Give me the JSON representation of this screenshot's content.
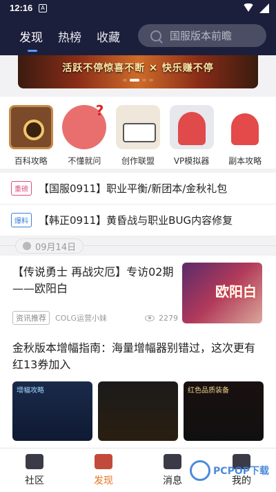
{
  "status": {
    "time": "12:16",
    "notif_icon": "A"
  },
  "header": {
    "tabs": [
      {
        "label": "发现",
        "active": true
      },
      {
        "label": "热榜",
        "active": false
      },
      {
        "label": "收藏",
        "active": false
      }
    ],
    "search_placeholder": "国服版本前瞻"
  },
  "banner": {
    "text": "活跃不停惊喜不断 ✕ 快乐赚不停"
  },
  "quick_links": [
    {
      "label": "百科攻略",
      "icon": "encyclopedia-book-icon"
    },
    {
      "label": "不懂就问",
      "icon": "ask-question-icon"
    },
    {
      "label": "创作联盟",
      "icon": "quill-book-icon"
    },
    {
      "label": "VP模拟器",
      "icon": "vp-simulator-icon"
    },
    {
      "label": "副本攻略",
      "icon": "dungeon-guide-icon"
    }
  ],
  "news": [
    {
      "tag": "重磅",
      "text": "【国服0911】职业平衡/新团本/金秋礼包"
    },
    {
      "tag": "爆料",
      "text": "【韩正0911】黄昏战与职业BUG内容修复"
    }
  ],
  "date_label": "09月14日",
  "article1": {
    "title": "【传说勇士 再战灾厄】专访02期——欧阳白",
    "badge": "资讯推荐",
    "author": "COLG运营小妹",
    "views": "2279",
    "thumb_text": "欧阳白"
  },
  "article2": {
    "title": "金秋版本增幅指南：海量增幅器别错过，这次更有红13券加入",
    "img_captions": [
      "增幅攻略",
      "",
      "红色品质装备"
    ]
  },
  "bottom_nav": [
    {
      "label": "社区",
      "active": false
    },
    {
      "label": "发现",
      "active": true
    },
    {
      "label": "消息",
      "active": false
    },
    {
      "label": "我的",
      "active": false
    }
  ],
  "watermark": "PCPOP下载"
}
